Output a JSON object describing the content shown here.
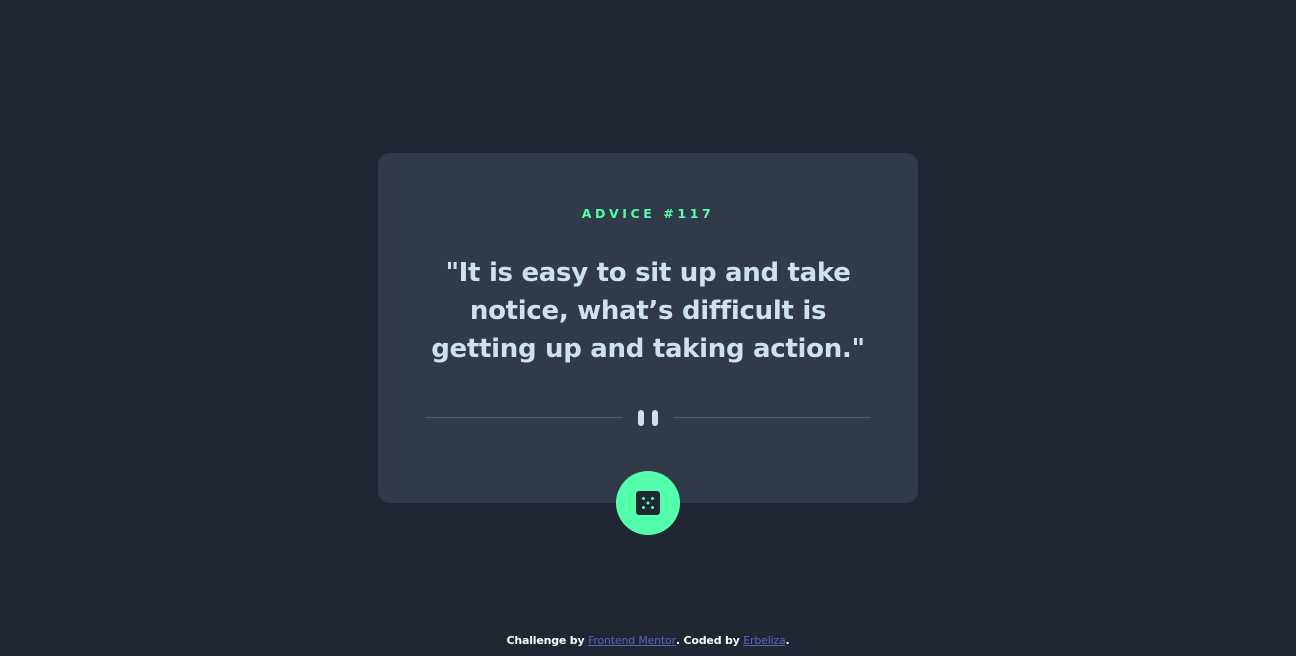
{
  "card": {
    "advice_label": "ADVICE #117",
    "quote": "\"It is easy to sit up and take notice, what’s difficult is getting up and taking action.\""
  },
  "divider": {
    "icon": "pause-icon"
  },
  "dice_button": {
    "icon": "dice-icon"
  },
  "footer": {
    "prefix": "Challenge by ",
    "link1": "Frontend Mentor",
    "middle": ". Coded by ",
    "link2": "Erbeliza",
    "suffix": "."
  },
  "colors": {
    "background": "#202632",
    "card": "#313a48",
    "accent": "#53ffaa",
    "text": "#cee3e9",
    "divider": "#4f5d74",
    "link": "#5565bf"
  }
}
